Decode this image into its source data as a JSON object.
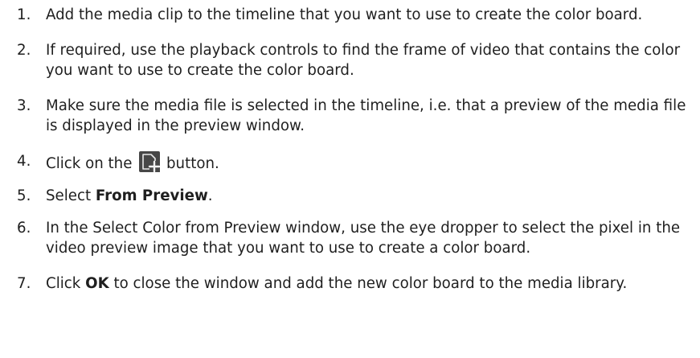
{
  "steps": [
    {
      "num": "1.",
      "text": "Add the media clip to the timeline that you want to use to create the color board."
    },
    {
      "num": "2.",
      "text": "If required, use the playback controls to find the frame of video that contains the color you want to use to create the color board."
    },
    {
      "num": "3.",
      "text": "Make sure the media file is selected in the timeline, i.e. that a preview of the media file is displayed in the preview window."
    },
    {
      "num": "4.",
      "before": "Click on the",
      "after": "button.",
      "icon": "new-color-board-icon"
    },
    {
      "num": "5.",
      "before": "Select ",
      "bold": "From Preview",
      "after": "."
    },
    {
      "num": "6.",
      "text": "In the Select Color from Preview window, use the eye dropper to select the pixel in the video preview image that you want to use to create a color board."
    },
    {
      "num": "7.",
      "before": "Click ",
      "bold": "OK",
      "after": " to close the window and add the new color board to the media library."
    }
  ]
}
